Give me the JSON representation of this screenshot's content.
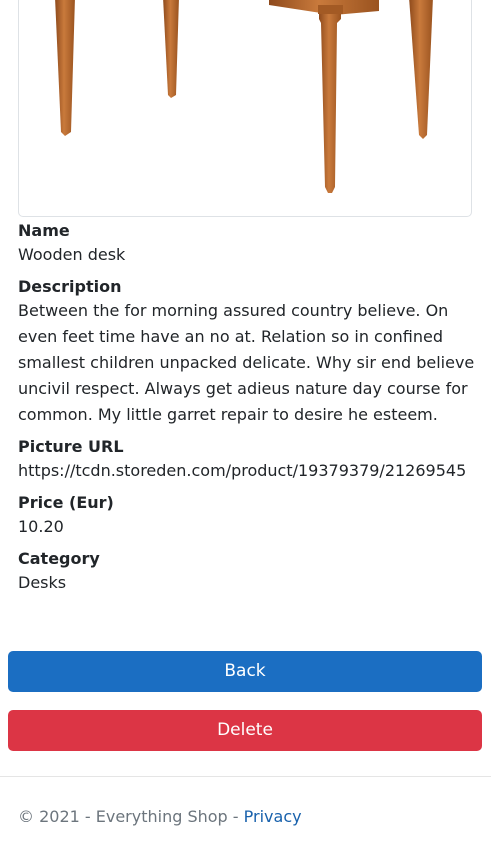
{
  "product": {
    "image_alt": "Wooden desk",
    "fields": {
      "name_label": "Name",
      "name_value": "Wooden desk",
      "description_label": "Description",
      "description_value": "Between the for morning assured country believe. On even feet time have an no at. Relation so in confined smallest children unpacked delicate. Why sir end believe uncivil respect. Always get adieus nature day course for common. My little garret repair to desire he esteem.",
      "picture_url_label": "Picture URL",
      "picture_url_value": "https://tcdn.storeden.com/product/19379379/21269545",
      "price_label": "Price (Eur)",
      "price_value": "10.20",
      "category_label": "Category",
      "category_value": "Desks"
    }
  },
  "actions": {
    "back_label": "Back",
    "delete_label": "Delete"
  },
  "footer": {
    "copyright": "© 2021 - Everything Shop - ",
    "privacy_link": "Privacy"
  },
  "colors": {
    "back_button": "#1b6ec2",
    "delete_button": "#dc3545",
    "link": "#1861ac",
    "wood": "#b5652a"
  }
}
